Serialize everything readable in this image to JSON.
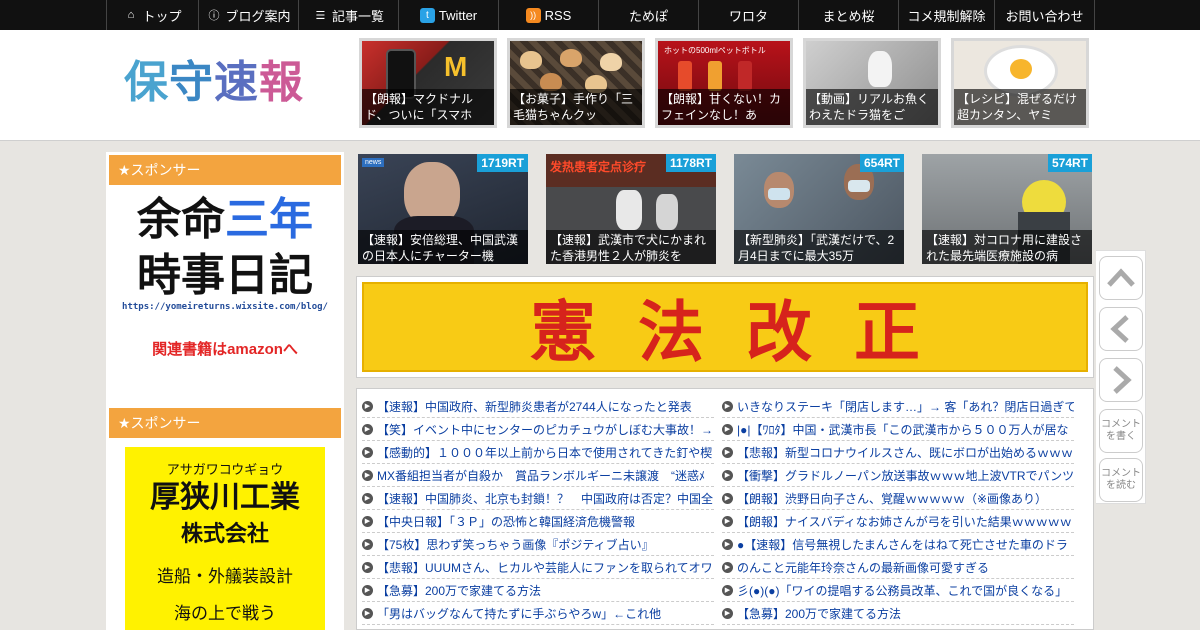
{
  "nav": {
    "items": [
      {
        "label": "トップ",
        "icon": "home-icon"
      },
      {
        "label": "ブログ案内",
        "icon": "info-icon"
      },
      {
        "label": "記事一覧",
        "icon": "list-icon"
      },
      {
        "label": "Twitter",
        "icon": "twitter-icon"
      },
      {
        "label": "RSS",
        "icon": "rss-icon"
      },
      {
        "label": "ためぽ"
      },
      {
        "label": "ワロタ"
      },
      {
        "label": "まとめ桜"
      },
      {
        "label": "コメ規制解除"
      },
      {
        "label": "お問い合わせ"
      }
    ]
  },
  "header": {
    "logo_text": "保守速報",
    "tiles": [
      {
        "caption": "【朗報】マクドナルド、ついに「スマホ"
      },
      {
        "caption": "【お菓子】手作り「三毛猫ちゃんクッ"
      },
      {
        "caption": "【朗報】甘くない！カフェインなし！あ",
        "label": "ホットの500mlペットボトル"
      },
      {
        "caption": "【動画】リアルお魚くわえたドラ猫をご"
      },
      {
        "caption": "【レシピ】混ぜるだけ超カンタン、ヤミ"
      }
    ]
  },
  "sidebar": {
    "sponsor1_title": "★スポンサー",
    "ad1": {
      "line1a": "余命",
      "line1b": "三年",
      "line2": "時事日記",
      "url": "https://yomeireturns.wixsite.com/blog/",
      "amazon": "関連書籍はamazonへ"
    },
    "sponsor2_title": "★スポンサー",
    "ad2": {
      "kana": "アサガワコウギョウ",
      "name": "厚狭川工業",
      "company": "株式会社",
      "business": "造船・外艤装設計",
      "last": "海の上で戦う"
    }
  },
  "news_tiles": [
    {
      "rt": "1719RT",
      "caption": "【速報】安倍総理、中国武漢の日本人にチャーター機"
    },
    {
      "rt": "1178RT",
      "caption": "【速報】武漢市で犬にかまれた香港男性２人が肺炎を",
      "label": "发热患者定点诊疗"
    },
    {
      "rt": "654RT",
      "caption": "【新型肺炎】「武漢だけで、2月4日までに最大35万"
    },
    {
      "rt": "574RT",
      "caption": "【速報】対コロナ用に建設された最先端医療施設の病"
    }
  ],
  "banner": {
    "text": "憲法改正"
  },
  "links_left": [
    "【速報】中国政府、新型肺炎患者が2744人になったと発表",
    "【笑】イベント中にセンターのピカチュウがしぼむ大事故！→",
    "【感動的】１０００年以上前から日本で使用されてきた釘や楔",
    "MX番組担当者が自殺か　賞品ランボルギーニ未譲渡　“迷惑ﾒ",
    "【速報】中国肺炎、北京も封鎖！？　中国政府は否定？中国全",
    "【中央日報】「３Ｐ」の恐怖と韓国経済危機警報",
    "【75枚】思わず笑っちゃう画像『ポジティブ占い』",
    "【悲報】UUUMさん、ヒカルや芸能人にファンを取られてオワ",
    "【急募】200万で家建てる方法",
    "「男はバッグなんて持たずに手ぶらやろw」←これ他"
  ],
  "links_right": [
    "いきなりステーキ「閉店します…」→ 客「あれ？閉店日過ぎて",
    "|●|【ﾜﾛﾀ】中国・武漢市長「この武漢市から５００万人が居な",
    "【悲報】新型コロナウイルスさん、既にボロが出始めるｗｗｗ",
    "【衝撃】グラドルノーパン放送事故ｗｗｗ地上波VTRでパンツ",
    "【朗報】渋野日向子さん、覚醒ｗｗｗｗｗ（※画像あり）",
    "【朗報】ナイスバディなお姉さんが弓を引いた結果ｗｗｗｗｗ",
    "●【速報】信号無視したまんさんをはねて死亡させた車のドラ",
    "のんこと元能年玲奈さんの最新画像可愛すぎる",
    "彡(●)(●)「ワイの提唱する公務員改革、これで国が良くなる」",
    "【急募】200万で家建てる方法"
  ],
  "right_nav": {
    "comment_write": "コメントを書く",
    "comment_read": "コメントを読む"
  }
}
